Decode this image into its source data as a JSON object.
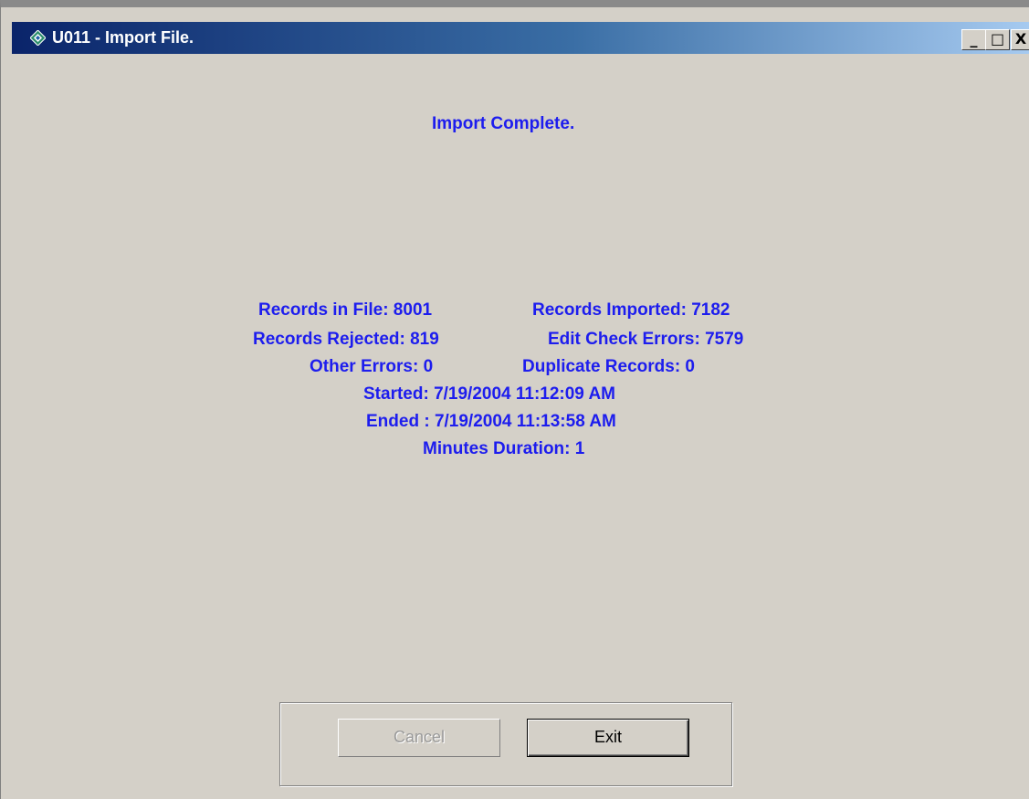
{
  "window": {
    "title": "U011 - Import File.",
    "controls": {
      "minimize": "_",
      "maximize": "□",
      "close": "X"
    }
  },
  "status": {
    "heading": "Import Complete.",
    "records_in_file": "Records in File: 8001",
    "records_imported": "Records Imported: 7182",
    "records_rejected": "Records Rejected: 819",
    "edit_check_errors": "Edit Check Errors: 7579",
    "other_errors": "Other Errors: 0",
    "duplicate_records": "Duplicate Records: 0",
    "started": "Started: 7/19/2004 11:12:09 AM",
    "ended": "Ended : 7/19/2004 11:13:58 AM",
    "duration": "Minutes Duration: 1"
  },
  "buttons": {
    "cancel": "Cancel",
    "exit": "Exit"
  },
  "colors": {
    "text_accent": "#1d1dee",
    "dialog_bg": "#d4d0c8",
    "title_start": "#0a246a",
    "title_end": "#a6caf0"
  },
  "icons": {
    "app": "app-diamond-icon"
  }
}
